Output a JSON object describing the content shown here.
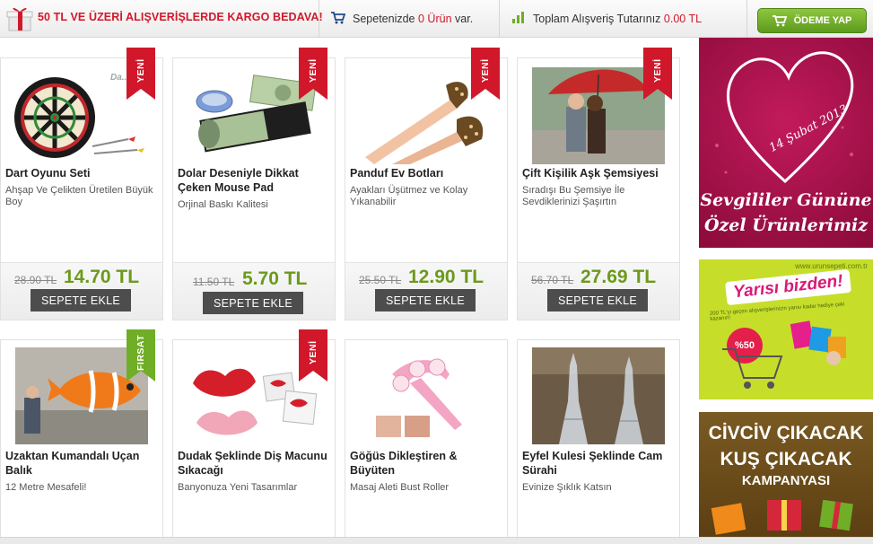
{
  "topbar": {
    "shipping_text": "50 TL VE ÜZERİ ALIŞVERİŞLERDE KARGO BEDAVA!",
    "cart_prefix": "Sepetenizde",
    "cart_count": "0 Ürün",
    "cart_suffix": "var.",
    "total_label": "Toplam Alışveriş Tutarınız",
    "total_value": "0.00 TL",
    "pay_button": "ÖDEME YAP",
    "colors": {
      "accent_red": "#d1182a",
      "pay_green": "#6fae26"
    }
  },
  "products": [
    {
      "name": "Dart Oyunu Seti",
      "desc": "Ahşap Ve Çelikten Üretilen Büyük Boy",
      "old_price": "28.90 TL",
      "new_price": "14.70 TL",
      "button": "SEPETE EKLE",
      "badge": "YENİ",
      "badge_color": "#d1182a",
      "image": "dartboard-image"
    },
    {
      "name": "Dolar Deseniyle Dikkat Çeken Mouse Pad",
      "desc": "Orjinal Baskı Kalitesi",
      "old_price": "11.50 TL",
      "new_price": "5.70 TL",
      "button": "SEPETE EKLE",
      "badge": "YENİ",
      "badge_color": "#d1182a",
      "image": "dollar-mousepad-image"
    },
    {
      "name": "Panduf Ev Botları",
      "desc": "Ayakları Üşütmez ve Kolay Yıkanabilir",
      "old_price": "25.50 TL",
      "new_price": "12.90 TL",
      "button": "SEPETE EKLE",
      "badge": "YENİ",
      "badge_color": "#d1182a",
      "image": "slipper-boots-image"
    },
    {
      "name": "Çift Kişilik Aşk Şemsiyesi",
      "desc": "Sıradışı Bu Şemsiye İle Sevdiklerinizi Şaşırtın",
      "old_price": "56.70 TL",
      "new_price": "27.69 TL",
      "button": "SEPETE EKLE",
      "badge": "YENİ",
      "badge_color": "#d1182a",
      "image": "couple-umbrella-image"
    },
    {
      "name": "Uzaktan Kumandalı Uçan Balık",
      "desc": "12 Metre Mesafeli!",
      "badge": "FIRSAT",
      "badge_color": "#6fae26",
      "image": "flying-fish-image"
    },
    {
      "name": "Dudak Şeklinde Diş Macunu Sıkacağı",
      "desc": "Banyonuza Yeni Tasarımlar",
      "badge": "YENİ",
      "badge_color": "#d1182a",
      "image": "lip-squeezer-image"
    },
    {
      "name": "Göğüs Dikleştiren & Büyüten",
      "desc": "Masaj Aleti Bust Roller",
      "image": "massage-roller-image"
    },
    {
      "name": "Eyfel Kulesi Şeklinde Cam Sürahi",
      "desc": "Evinize Şıklık Katsın",
      "image": "eiffel-carafe-image"
    }
  ],
  "banners": {
    "valentine": {
      "date": "14 Şubat 2013",
      "line1": "Sevgililer Gününe",
      "line2": "Özel Ürünlerimiz"
    },
    "half": {
      "url": "www.urunsepeti.com.tr",
      "title": "Yarısı bizden!",
      "subtitle": "200 TL'yi geçen alışverişlerinizin yarısı kadar hediye çeki kazanın!",
      "percent": "%50"
    },
    "chick": {
      "line1": "CİVCİV ÇIKACAK",
      "line2": "KUŞ ÇIKACAK",
      "line3": "KAMPANYASI"
    }
  }
}
